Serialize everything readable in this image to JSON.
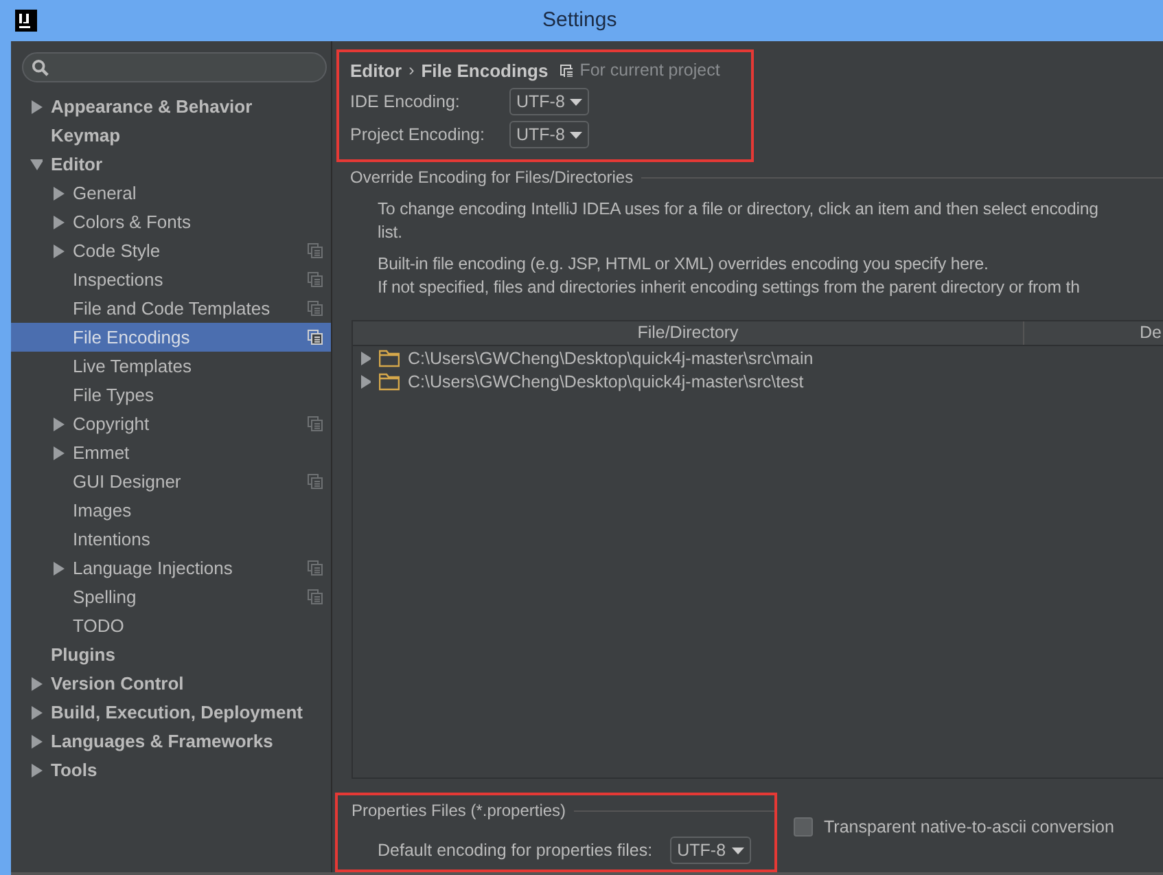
{
  "window": {
    "title": "Settings"
  },
  "sidebar": {
    "items": [
      {
        "label": "Appearance & Behavior",
        "expandable": true,
        "expanded": false,
        "selected": false,
        "project_scope": false
      },
      {
        "label": "Keymap",
        "expandable": false,
        "selected": false,
        "project_scope": false
      },
      {
        "label": "Editor",
        "expandable": true,
        "expanded": true,
        "selected": false,
        "project_scope": false,
        "children": [
          {
            "label": "General",
            "expandable": true,
            "expanded": false,
            "selected": false,
            "project_scope": false
          },
          {
            "label": "Colors & Fonts",
            "expandable": true,
            "expanded": false,
            "selected": false,
            "project_scope": false
          },
          {
            "label": "Code Style",
            "expandable": true,
            "expanded": false,
            "selected": false,
            "project_scope": true
          },
          {
            "label": "Inspections",
            "expandable": false,
            "selected": false,
            "project_scope": true
          },
          {
            "label": "File and Code Templates",
            "expandable": false,
            "selected": false,
            "project_scope": true
          },
          {
            "label": "File Encodings",
            "expandable": false,
            "selected": true,
            "project_scope": true
          },
          {
            "label": "Live Templates",
            "expandable": false,
            "selected": false,
            "project_scope": false
          },
          {
            "label": "File Types",
            "expandable": false,
            "selected": false,
            "project_scope": false
          },
          {
            "label": "Copyright",
            "expandable": true,
            "expanded": false,
            "selected": false,
            "project_scope": true
          },
          {
            "label": "Emmet",
            "expandable": true,
            "expanded": false,
            "selected": false,
            "project_scope": false
          },
          {
            "label": "GUI Designer",
            "expandable": false,
            "selected": false,
            "project_scope": true
          },
          {
            "label": "Images",
            "expandable": false,
            "selected": false,
            "project_scope": false
          },
          {
            "label": "Intentions",
            "expandable": false,
            "selected": false,
            "project_scope": false
          },
          {
            "label": "Language Injections",
            "expandable": true,
            "expanded": false,
            "selected": false,
            "project_scope": true
          },
          {
            "label": "Spelling",
            "expandable": false,
            "selected": false,
            "project_scope": true
          },
          {
            "label": "TODO",
            "expandable": false,
            "selected": false,
            "project_scope": false
          }
        ]
      },
      {
        "label": "Plugins",
        "expandable": false,
        "selected": false,
        "project_scope": false
      },
      {
        "label": "Version Control",
        "expandable": true,
        "expanded": false,
        "selected": false,
        "project_scope": false
      },
      {
        "label": "Build, Execution, Deployment",
        "expandable": true,
        "expanded": false,
        "selected": false,
        "project_scope": false
      },
      {
        "label": "Languages & Frameworks",
        "expandable": true,
        "expanded": false,
        "selected": false,
        "project_scope": false
      },
      {
        "label": "Tools",
        "expandable": true,
        "expanded": false,
        "selected": false,
        "project_scope": false
      }
    ]
  },
  "breadcrumb": {
    "parent": "Editor",
    "separator": "›",
    "current": "File Encodings",
    "scope_note": "For current project"
  },
  "encodings": [
    {
      "label": "IDE Encoding:",
      "value": "UTF-8"
    },
    {
      "label": "Project Encoding:",
      "value": "UTF-8"
    }
  ],
  "override": {
    "title": "Override Encoding for Files/Directories",
    "paragraphs": [
      [
        "To change encoding IntelliJ IDEA uses for a file or directory, click an item and then select encoding",
        "list."
      ],
      [
        "Built-in file encoding (e.g. JSP, HTML or XML) overrides encoding you specify here.",
        "If not specified, files and directories inherit encoding settings from the parent directory or from th"
      ]
    ],
    "table": {
      "columns": [
        "File/Directory",
        "De"
      ],
      "rows": [
        {
          "path": "C:\\Users\\GWCheng\\Desktop\\quick4j-master\\src\\main",
          "expanded": false
        },
        {
          "path": "C:\\Users\\GWCheng\\Desktop\\quick4j-master\\src\\test",
          "expanded": false
        }
      ]
    }
  },
  "properties": {
    "title": "Properties Files (*.properties)",
    "label": "Default encoding for properties files:",
    "value": "UTF-8",
    "checkbox": {
      "label": "Transparent native-to-ascii conversion",
      "checked": false
    }
  }
}
